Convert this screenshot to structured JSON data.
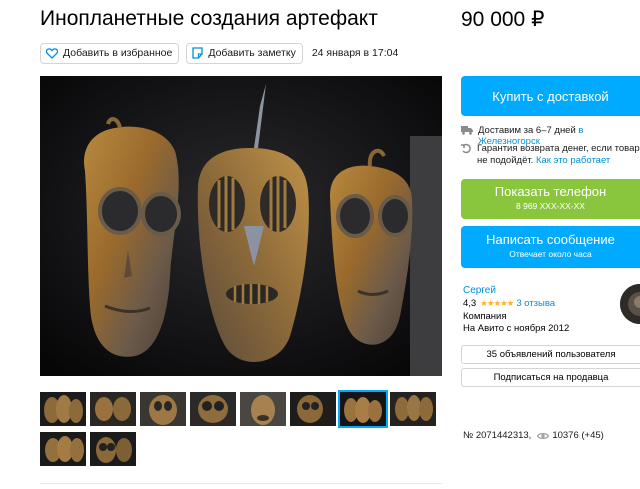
{
  "listing": {
    "title": "Инопланетные создания артефакт",
    "price": "90 000 ₽",
    "date": "24 января в 17:04",
    "number": "№ 2071442313,",
    "views": "10376 (+45)"
  },
  "actions": {
    "favorite_label": "Добавить в избранное",
    "note_label": "Добавить заметку"
  },
  "gallery": {
    "thumbnail_count": 9,
    "active_index": 6
  },
  "buy": {
    "buy_label": "Купить с доставкой",
    "delivery_text": "Доставим за 6–7 дней",
    "delivery_city": "в Железногорск",
    "guarantee_text": "Гарантия возврата денег, если товар не подойдёт.",
    "guarantee_link": "Как это работает"
  },
  "contact": {
    "phone_label": "Показать телефон",
    "phone_masked": "8 969 XXX-XX-XX",
    "message_label": "Написать сообщение",
    "message_sub": "Отвечает около часа"
  },
  "seller": {
    "name": "Сергей",
    "rating": "4,3",
    "stars": "★★★★★",
    "reviews": "3 отзыва",
    "type": "Компания",
    "since": "На Авито с ноября 2012",
    "ads_label": "35 объявлений пользователя",
    "subscribe_label": "Подписаться на продавца"
  },
  "colors": {
    "accent_blue": "#00aaff",
    "accent_green": "#8ac63d",
    "link": "#0091d9",
    "star": "#ffb021"
  },
  "icons": {
    "favorite": "heart-icon",
    "note": "note-icon",
    "delivery": "truck-icon",
    "guarantee": "refund-icon",
    "views": "eye-icon"
  }
}
